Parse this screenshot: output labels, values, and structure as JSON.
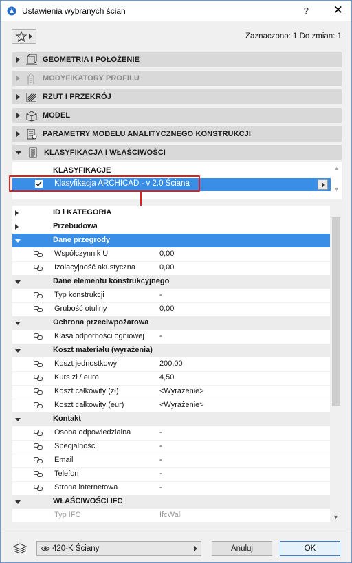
{
  "window": {
    "title": "Ustawienia wybranych ścian",
    "help": "?",
    "close": "✕"
  },
  "header": {
    "selection_info": "Zaznaczono: 1 Do zmian: 1"
  },
  "panels": [
    {
      "label": "GEOMETRIA I POŁOŻENIE",
      "icon": "geometry-icon"
    },
    {
      "label": "MODYFIKATORY PROFILU",
      "icon": "profile-modifier-icon"
    },
    {
      "label": "RZUT I PRZEKRÓJ",
      "icon": "floor-plan-icon"
    },
    {
      "label": "MODEL",
      "icon": "model-icon"
    },
    {
      "label": "PARAMETRY MODELU ANALITYCZNEGO KONSTRUKCJI",
      "icon": "structural-analytical-icon"
    },
    {
      "label": "KLASYFIKACJA I WŁAŚCIWOŚCI",
      "icon": "classification-icon"
    }
  ],
  "classification": {
    "title": "KLASYFIKACJE",
    "row": "Klasyfikacja ARCHICAD - v 2.0 Ściana"
  },
  "properties": [
    {
      "type": "group",
      "label": "ID i KATEGORIA"
    },
    {
      "type": "group",
      "label": "Przebudowa"
    },
    {
      "type": "group",
      "label": "Dane przegrody"
    },
    {
      "type": "item",
      "label": "Współczynnik U",
      "value": "0,00"
    },
    {
      "type": "item",
      "label": "Izolacyjność akustyczna",
      "value": "0,00"
    },
    {
      "type": "group",
      "label": "Dane elementu konstrukcyjnego"
    },
    {
      "type": "item",
      "label": "Typ konstrukcji",
      "value": "-"
    },
    {
      "type": "item",
      "label": "Grubość otuliny",
      "value": "0,00"
    },
    {
      "type": "group",
      "label": "Ochrona przeciwpożarowa"
    },
    {
      "type": "item",
      "label": "Klasa odporności ogniowej",
      "value": "-"
    },
    {
      "type": "group",
      "label": "Koszt materiału (wyrażenia)"
    },
    {
      "type": "item",
      "label": "Koszt jednostkowy",
      "value": "200,00"
    },
    {
      "type": "item",
      "label": "Kurs zł / euro",
      "value": "4,50"
    },
    {
      "type": "item",
      "label": "Koszt całkowity (zł)",
      "value": "<Wyrażenie>"
    },
    {
      "type": "item",
      "label": "Koszt całkowity (eur)",
      "value": "<Wyrażenie>"
    },
    {
      "type": "group",
      "label": "Kontakt"
    },
    {
      "type": "item",
      "label": "Osoba odpowiedzialna",
      "value": "-"
    },
    {
      "type": "item",
      "label": "Specjalność",
      "value": "-"
    },
    {
      "type": "item",
      "label": "Email",
      "value": "-"
    },
    {
      "type": "item",
      "label": "Telefon",
      "value": "-"
    },
    {
      "type": "item",
      "label": "Strona internetowa",
      "value": "-"
    },
    {
      "type": "group",
      "label": "WŁAŚCIWOŚCI IFC"
    },
    {
      "type": "item",
      "label": "Typ IFC",
      "value": "IfcWall"
    }
  ],
  "footer": {
    "layer": "420-K Ściany",
    "cancel": "Anuluj",
    "ok": "OK"
  },
  "colors": {
    "selection": "#3a8ee6",
    "highlight_box": "#e02020"
  }
}
